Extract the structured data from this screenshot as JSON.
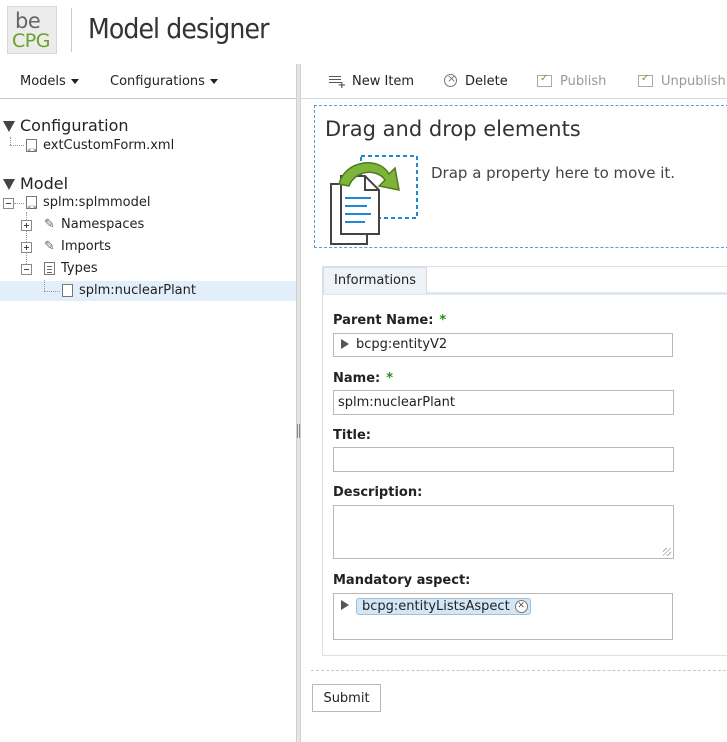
{
  "header": {
    "logo_top": "be",
    "logo_bottom": "CPG",
    "title": "Model designer"
  },
  "left_toolbar": {
    "models_label": "Models",
    "configurations_label": "Configurations"
  },
  "tree": {
    "configuration": {
      "label": "Configuration",
      "children": [
        "extCustomForm.xml"
      ]
    },
    "model": {
      "label": "Model",
      "root": "splm:splmmodel",
      "namespaces": "Namespaces",
      "imports": "Imports",
      "types": "Types",
      "selected_type": "splm:nuclearPlant"
    }
  },
  "right_toolbar": {
    "new_item": "New Item",
    "delete": "Delete",
    "publish": "Publish",
    "unpublish": "Unpublish"
  },
  "dropzone": {
    "title": "Drag and drop elements",
    "text": "Drap a property here to move it."
  },
  "form": {
    "tab": "Informations",
    "parent_name_label": "Parent Name:",
    "parent_name_value": "bcpg:entityV2",
    "name_label": "Name:",
    "name_value": "splm:nuclearPlant",
    "title_label": "Title:",
    "title_value": "",
    "description_label": "Description:",
    "description_value": "",
    "mandatory_aspect_label": "Mandatory aspect:",
    "mandatory_aspect_value": "bcpg:entityListsAspect",
    "required_mark": "*",
    "submit_label": "Submit"
  },
  "colors": {
    "accent_green": "#6aa12a",
    "selection_blue": "#e2eef9",
    "dropzone_border": "#5b9bd5"
  }
}
